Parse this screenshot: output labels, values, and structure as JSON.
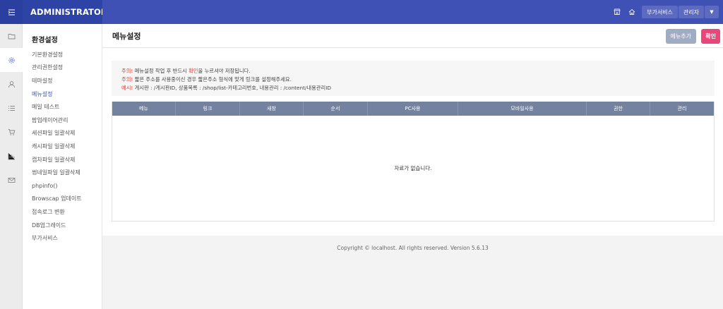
{
  "header": {
    "brand": "ADMINISTRATOR",
    "addon_label": "부가서비스",
    "admin_label": "관리자"
  },
  "icons": {
    "menu_toggle": "indent-icon",
    "store": "store-icon",
    "home": "home-icon",
    "dropdown": "caret-down-icon"
  },
  "rail": [
    "folder-icon",
    "gear-icon",
    "user-icon",
    "list-icon",
    "cart-icon",
    "bar-chart-icon",
    "mail-icon"
  ],
  "submenu": {
    "title": "환경설정",
    "items": [
      {
        "label": "기본환경설정"
      },
      {
        "label": "관리권한설정"
      },
      {
        "label": "테마설정"
      },
      {
        "label": "메뉴설정",
        "active": true
      },
      {
        "label": "메일 테스트"
      },
      {
        "label": "팝업레이어관리"
      },
      {
        "label": "세션파일 일괄삭제"
      },
      {
        "label": "캐시파일 일괄삭제"
      },
      {
        "label": "캡차파일 일괄삭제"
      },
      {
        "label": "썸네일파일 일괄삭제"
      },
      {
        "label": "phpinfo()"
      },
      {
        "label": "Browscap 업데이트"
      },
      {
        "label": "접속로그 변환"
      },
      {
        "label": "DB업그레이드"
      },
      {
        "label": "부가서비스"
      }
    ]
  },
  "page": {
    "title": "메뉴설정",
    "add_button": "메뉴추가",
    "ok_button": "확인"
  },
  "notice": {
    "line1_prefix": "주의!",
    "line1_a": " 메뉴설정 작업 후 반드시 ",
    "line1_ok": "확인",
    "line1_b": "을 누르셔야 저장됩니다.",
    "line2_prefix": "주의!",
    "line2": " 짧은 주소를 사용중이신 경우 짧은주소 형식에 맞게 링크를 설정해주세요.",
    "line3_prefix": "예시!",
    "line3": " 게시판 : /게시판ID, 상품목록 : /shop/list-카테고리번호, 내용관리 : /content/내용관리ID"
  },
  "table": {
    "columns": [
      "메뉴",
      "링크",
      "새창",
      "순서",
      "PC사용",
      "모바일사용",
      "권한",
      "관리"
    ],
    "empty_text": "자료가 없습니다."
  },
  "colors": {
    "topbar": "#3f51b5",
    "accent": "#3f51b5",
    "ok_button": "#e9467a",
    "add_button": "#a0abc4",
    "table_header": "#74819f",
    "warning": "#e53935"
  },
  "footer": {
    "text": "Copyright © localhost. All rights reserved. Version 5.6.13"
  }
}
